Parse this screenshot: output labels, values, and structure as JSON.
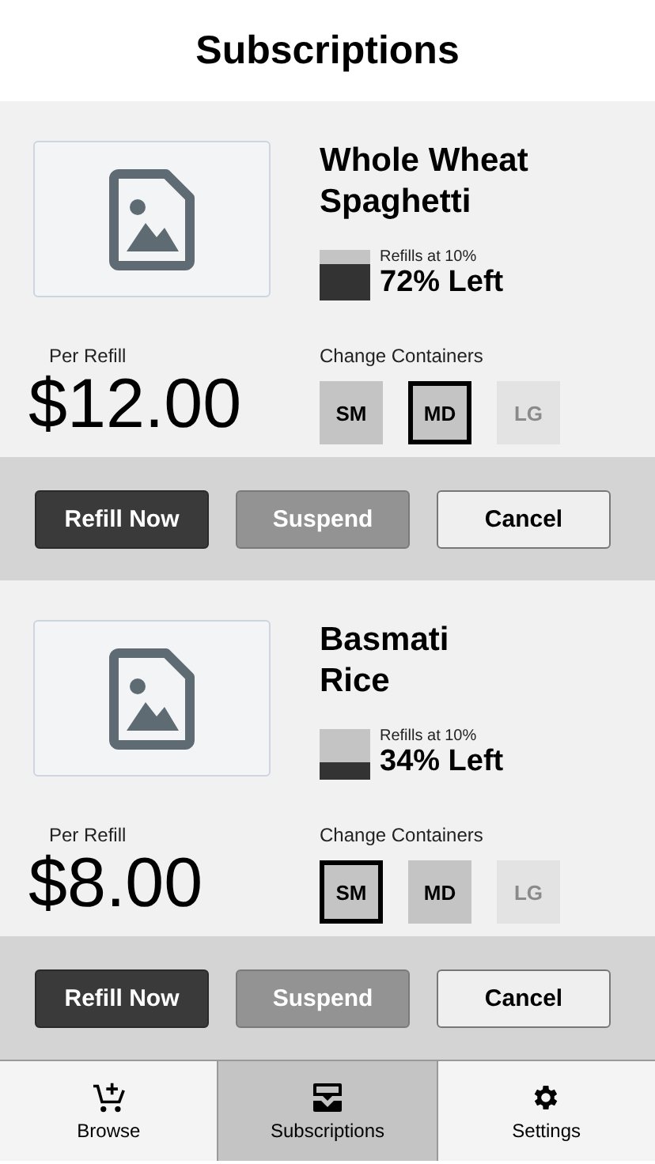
{
  "title": "Subscriptions",
  "subscriptions": [
    {
      "name": "Whole Wheat\nSpaghetti",
      "refill_note": "Refills at 10%",
      "remaining": "72% Left",
      "price_label": "Per Refill",
      "price": "$12.00",
      "containers_label": "Change Containers",
      "sizes": [
        {
          "label": "SM",
          "selected": false,
          "disabled": false
        },
        {
          "label": "MD",
          "selected": true,
          "disabled": false
        },
        {
          "label": "LG",
          "selected": false,
          "disabled": true
        }
      ],
      "actions": [
        {
          "label": "Refill Now",
          "kind": "primary"
        },
        {
          "label": "Suspend",
          "kind": "secondary"
        },
        {
          "label": "Cancel",
          "kind": "outline"
        }
      ]
    },
    {
      "name": "Basmati\nRice",
      "refill_note": "Refills at 10%",
      "remaining": "34% Left",
      "price_label": "Per Refill",
      "price": "$8.00",
      "containers_label": "Change Containers",
      "sizes": [
        {
          "label": "SM",
          "selected": true,
          "disabled": false
        },
        {
          "label": "MD",
          "selected": false,
          "disabled": false
        },
        {
          "label": "LG",
          "selected": false,
          "disabled": true
        }
      ],
      "actions": [
        {
          "label": "Refill Now",
          "kind": "primary"
        },
        {
          "label": "Suspend",
          "kind": "secondary"
        },
        {
          "label": "Cancel",
          "kind": "outline"
        }
      ]
    }
  ],
  "nav": [
    {
      "label": "Browse",
      "selected": false
    },
    {
      "label": "Subscriptions",
      "selected": true
    },
    {
      "label": "Settings",
      "selected": false
    }
  ]
}
